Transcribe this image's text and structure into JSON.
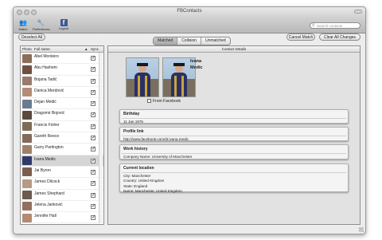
{
  "window": {
    "title": "FBContacts",
    "toolbar": {
      "match": "Match",
      "preferences": "Preferences",
      "logout": "Logout",
      "search_placeholder": "Search contacts"
    },
    "buttons": {
      "deselect_all": "Deselect All",
      "cancel_match": "Cancel Match",
      "clear_all_changes": "Clear All Changes"
    },
    "segments": [
      "Matched",
      "Collision",
      "Unmatched"
    ],
    "selected_segment": "Matched"
  },
  "contact_list": {
    "headers": {
      "photo": "Photo",
      "full_name": "Full name",
      "sort_arrow": "▲",
      "sync": "Sync"
    },
    "rows": [
      {
        "name": "Abel Monteiro",
        "checked": true,
        "thumb": "#8b6d59"
      },
      {
        "name": "Abu Hashem",
        "checked": true,
        "thumb": "#6f5142"
      },
      {
        "name": "Bojana Tadić",
        "checked": true,
        "thumb": "#9a7a6c"
      },
      {
        "name": "Danica Merdović",
        "checked": true,
        "thumb": "#b48b76"
      },
      {
        "name": "Dejan Medić",
        "checked": true,
        "thumb": "#6b7b8f"
      },
      {
        "name": "Dragomir Bojović",
        "checked": true,
        "thumb": "#5a4a3d"
      },
      {
        "name": "Francis Fisher",
        "checked": true,
        "thumb": "#7f6b55"
      },
      {
        "name": "Gareth Reece",
        "checked": true,
        "thumb": "#846a5a"
      },
      {
        "name": "Garry Partington",
        "checked": true,
        "thumb": "#a08168"
      },
      {
        "name": "Ivana Medic",
        "checked": true,
        "thumb": "#2f3a6b",
        "selected": true
      },
      {
        "name": "Jai Byron",
        "checked": true,
        "thumb": "#7d5d4c"
      },
      {
        "name": "James Dilcock",
        "checked": true,
        "thumb": "#b69a86"
      },
      {
        "name": "James Shephard",
        "checked": true,
        "thumb": "#6c5a4f"
      },
      {
        "name": "Jelena Janković",
        "checked": true,
        "thumb": "#946f5e"
      },
      {
        "name": "Jennifer Hall",
        "checked": true,
        "thumb": "#b38a73"
      }
    ]
  },
  "details": {
    "header": "Contact Details",
    "first_name": "Ivana",
    "last_name": "Medic",
    "from_facebook": "From Facebook",
    "cards": [
      {
        "title": "Birthday",
        "lines": [
          "11 Jan 1975"
        ]
      },
      {
        "title": "Profile link",
        "lines": [
          "http://www.facebook.com/dr.ivana.medic"
        ]
      },
      {
        "title": "Work history",
        "lines": [
          "Company Name: University of Manchester"
        ]
      },
      {
        "title": "Current location",
        "lines": [
          "City: Manchester",
          "Country: United Kingdom",
          "State: England",
          "Name: Manchester, United Kingdom"
        ]
      }
    ]
  }
}
